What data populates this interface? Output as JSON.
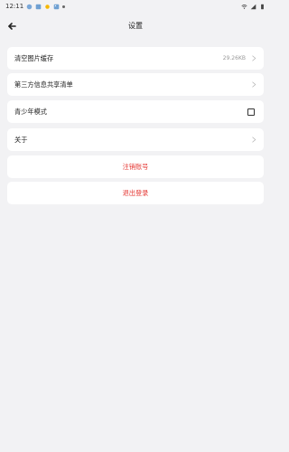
{
  "status": {
    "time": "12:11"
  },
  "header": {
    "title": "设置"
  },
  "items": {
    "cache": {
      "label": "清空图片缓存",
      "value": "29.26KB"
    },
    "share_list": {
      "label": "第三方信息共享清单"
    },
    "youth_mode": {
      "label": "青少年模式",
      "checked": false
    },
    "about": {
      "label": "关于"
    }
  },
  "actions": {
    "delete_account": "注销账号",
    "logout": "退出登录"
  },
  "colors": {
    "accent": "#e53935",
    "background": "#f2f2f4",
    "card": "#ffffff"
  },
  "icons": {
    "back": "back-arrow-icon",
    "chevron": "chevron-right-icon",
    "checkbox": "checkbox-icon"
  }
}
